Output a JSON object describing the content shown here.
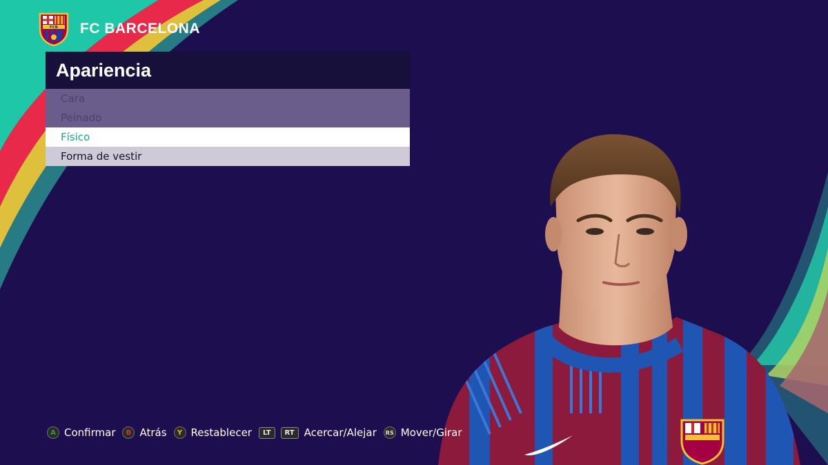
{
  "header": {
    "club_name": "FC BARCELONA",
    "crest_text": "FCB"
  },
  "panel": {
    "title": "Apariencia",
    "items": [
      {
        "label": "Cara",
        "state": "disabled"
      },
      {
        "label": "Peinado",
        "state": "disabled"
      },
      {
        "label": "Físico",
        "state": "selected"
      },
      {
        "label": "Forma de vestir",
        "state": "normal"
      }
    ]
  },
  "hints": [
    {
      "button": "A",
      "label": "Confirmar",
      "color": "#2e9e3a"
    },
    {
      "button": "B",
      "label": "Atrás",
      "color": "#d2352a"
    },
    {
      "button": "Y",
      "label": "Restablecer",
      "color": "#e0b820"
    },
    {
      "button": "LT",
      "label": ""
    },
    {
      "button": "RT",
      "label": "Acercar/Alejar"
    },
    {
      "button": "RS",
      "label": "Mover/Girar",
      "color": "#dddddd"
    }
  ],
  "colors": {
    "background": "#1d0f4f",
    "selected_text": "#12a99a",
    "swoosh_teal": "#2fd6b2",
    "swoosh_red": "#e8294a",
    "swoosh_yellow": "#f4d43a"
  }
}
